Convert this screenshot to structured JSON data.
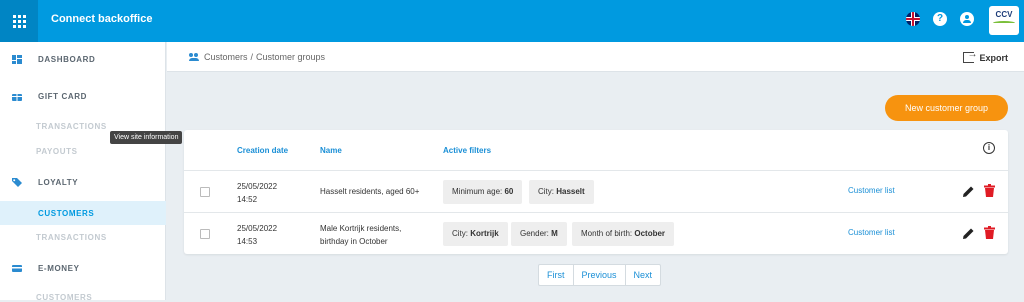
{
  "app": {
    "title": "Connect backoffice",
    "logo_text": "CCV"
  },
  "topbar": {
    "help_label": "?"
  },
  "sidebar": {
    "dashboard": "DASHBOARD",
    "gift_card": "GIFT CARD",
    "gift_transactions": "TRANSACTIONS",
    "payouts": "PAYOUTS",
    "loyalty": "LOYALTY",
    "customers": "CUSTOMERS",
    "loyalty_transactions": "TRANSACTIONS",
    "e_money": "E-MONEY",
    "e_money_customers": "CUSTOMERS"
  },
  "tooltip": "View site information",
  "breadcrumb": {
    "parent": "Customers",
    "separator": "/",
    "current": "Customer groups"
  },
  "header": {
    "export_label": "Export"
  },
  "actions": {
    "new_group_label": "New customer group"
  },
  "table": {
    "columns": {
      "creation_date": "Creation date",
      "name": "Name",
      "active_filters": "Active filters"
    },
    "info_label": "i",
    "rows": [
      {
        "date": "25/05/2022",
        "time": "14:52",
        "name_line1": "Hasselt residents, aged 60+",
        "name_line2": "",
        "filters": [
          {
            "label": "Minimum age:",
            "value": "60"
          },
          {
            "label": "City:",
            "value": "Hasselt"
          }
        ],
        "link": "Customer list"
      },
      {
        "date": "25/05/2022",
        "time": "14:53",
        "name_line1": "Male Kortrijk residents,",
        "name_line2": "birthday in October",
        "filters": [
          {
            "label": "City:",
            "value": "Kortrijk"
          },
          {
            "label": "Gender:",
            "value": "M"
          },
          {
            "label": "Month of birth:",
            "value": "October"
          }
        ],
        "link": "Customer list"
      }
    ]
  },
  "pagination": {
    "first": "First",
    "previous": "Previous",
    "next": "Next"
  },
  "colors": {
    "primary": "#009ae0",
    "accent": "#f7930f",
    "delete": "#e01b24"
  }
}
